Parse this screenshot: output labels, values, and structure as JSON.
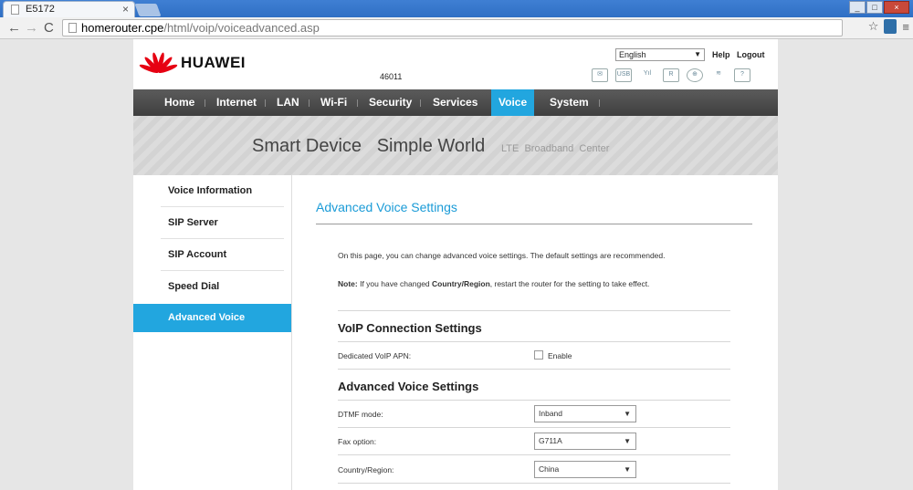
{
  "browser": {
    "tab_title": "E5172",
    "tab_close": "×",
    "url_host": "homerouter.cpe",
    "url_path": "/html/voip/voiceadvanced.asp",
    "back": "←",
    "forward": "→",
    "reload": "C",
    "star": "☆",
    "menu": "≡",
    "win_min": "_",
    "win_max": "□",
    "win_close": "×"
  },
  "header": {
    "brand": "HUAWEI",
    "model": "46011",
    "language": "English",
    "help": "Help",
    "logout": "Logout",
    "status_icons": [
      "mail-icon",
      "usb-icon",
      "signal-icon",
      "roaming-icon",
      "internet-globe-icon",
      "wifi-icon",
      "help-icon"
    ],
    "status_labels": [
      "✉",
      "USB",
      "Yıl",
      "R",
      "⊕",
      "≋",
      "?"
    ]
  },
  "nav": {
    "items": [
      "Home",
      "Internet",
      "LAN",
      "Wi-Fi",
      "Security",
      "Services",
      "Voice",
      "System"
    ],
    "active": "Voice"
  },
  "banner": {
    "slogan": "Smart Device   Simple World",
    "subtitle": "LTE  Broadband  Center"
  },
  "sidebar": {
    "items": [
      "Voice Information",
      "SIP Server",
      "SIP Account",
      "Speed Dial",
      "Advanced Voice"
    ],
    "active": "Advanced Voice"
  },
  "content": {
    "title": "Advanced Voice Settings",
    "description": "On this page, you can change advanced voice settings. The default settings are recommended.",
    "note_label": "Note:",
    "note_pre": " If you have changed ",
    "note_bold": "Country/Region",
    "note_post": ", restart the router for the setting to take effect.",
    "voip_section": "VoIP Connection Settings",
    "dedicated_apn_label": "Dedicated VoIP APN:",
    "dedicated_apn_checkbox": "Enable",
    "adv_section": "Advanced Voice Settings",
    "dtmf_label": "DTMF mode:",
    "dtmf_value": "Inband",
    "fax_label": "Fax option:",
    "fax_value": "G711A",
    "country_label": "Country/Region:",
    "country_value": "China"
  },
  "colors": {
    "accent": "#22a6df",
    "nav_bg": "#484848",
    "brand_red": "#e60012"
  }
}
